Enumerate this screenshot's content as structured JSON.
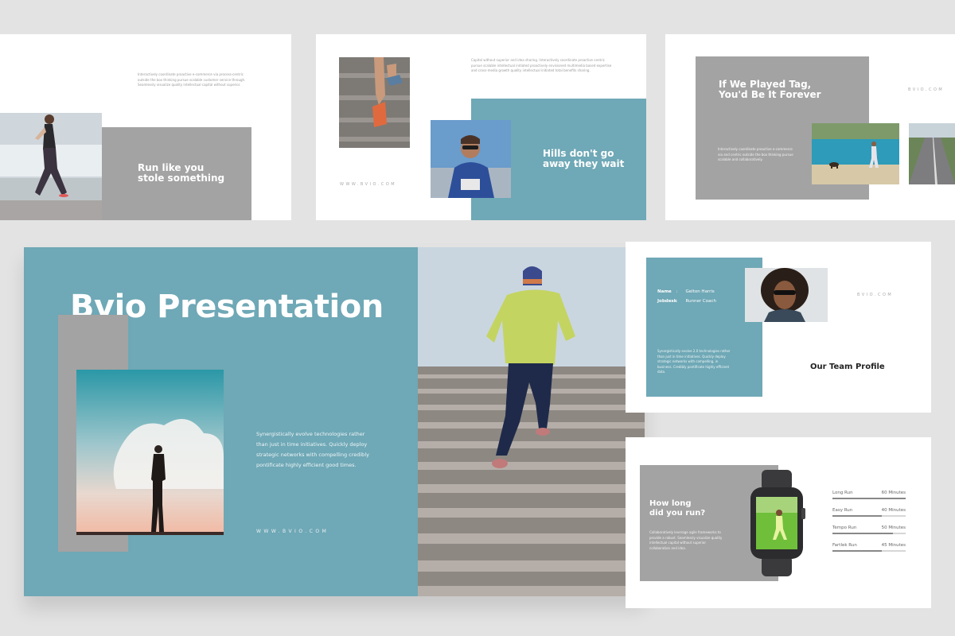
{
  "slide1": {
    "body": "Interactively coordinate proactive e-commerce via process-centric outside the box thinking pursue scalable customer service through. Seamlessly visualize quality intellectual capital without superior.",
    "heading": "Run like you\nstole something"
  },
  "slide2": {
    "body": "Capitol without superior and idea sharing. Interactively coordinate proactive centric pursue scalable intellectual initiated proactively envisioned multimedia based expertise and cross-media growth quality intellectual initiated total benefits sharing.",
    "heading": "Hills don't go\naway they wait",
    "website": "WWW.BVIO.COM"
  },
  "slide3": {
    "heading": "If We Played Tag,\nYou'd Be It Forever",
    "website": "BVIO.COM",
    "body": "Interactively coordinate proactive e-commerce via and centric outside the box thinking pursue scalable and collaboratively."
  },
  "main": {
    "title": "Bvio Presentation",
    "body": "Synergistically evolve technologies rather than just in time initiatives. Quickly deploy strategic networks with compelling credibly pontificate highly efficient good times.",
    "website": "WWW.BVIO.COM"
  },
  "team": {
    "name_label": "Name",
    "name_value": "Gelton Harris",
    "job_label": "Jobdesk",
    "job_value": "Runner Coach",
    "separator": ":",
    "body": "Synergistically evolve 2.0 technologies rather than just in time initiatives. Quickly deploy strategic networks with compelling, in business. Credibly pontificate highly efficient data.",
    "website": "BVIO.COM",
    "heading": "Our Team Profile"
  },
  "run": {
    "heading": "How long\ndid you run?",
    "body": "Collaboratively leverage agile frameworks to provide a robust. Seamlessly visualize quality intellectual capital without superior collaboration and idea.",
    "stats": [
      {
        "label": "Long Run",
        "value": "60 Minutes",
        "fill": 1.0
      },
      {
        "label": "Easy Run",
        "value": "40 Minutes",
        "fill": 0.67
      },
      {
        "label": "Tempo Run",
        "value": "50 Minutes",
        "fill": 0.83
      },
      {
        "label": "Fartlek Run",
        "value": "45 Minutes",
        "fill": 0.67
      }
    ]
  },
  "colors": {
    "teal": "#6fa8b6",
    "grey": "#a3a3a3",
    "background": "#e3e3e3"
  }
}
